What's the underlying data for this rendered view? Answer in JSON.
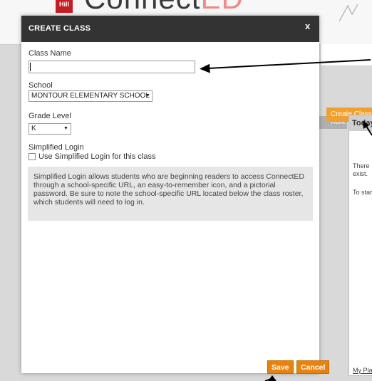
{
  "background": {
    "logo_small": "Hill",
    "logo_text": "Connect",
    "logo_text_accent": "ED",
    "create_class_button": "Create Class",
    "tab_partial": "nent",
    "panel": {
      "heading": "Today",
      "text_line1": "There",
      "text_line2": "exist.",
      "text_line3": "To star",
      "footer_link": "My Plan"
    }
  },
  "modal": {
    "title": "CREATE CLASS",
    "close_label": "x",
    "class_name": {
      "label": "Class Name",
      "value": ""
    },
    "school": {
      "label": "School",
      "selected": "MONTOUR ELEMENTARY SCHOOL"
    },
    "grade_level": {
      "label": "Grade Level",
      "selected": "K"
    },
    "simplified_login": {
      "label": "Simplified Login",
      "checkbox_label": "Use Simplified Login for this class",
      "checked": false,
      "info_text": "Simplified Login allows students who are beginning readers to access ConnectED through a school-specific URL, an easy-to-remember icon, and a pictorial password. Be sure to note the school-specific URL located below the class roster, which students will need to log in."
    },
    "save_label": "Save",
    "cancel_label": "Cancel"
  },
  "colors": {
    "header_bg": "#333333",
    "accent_orange": "#e8820e",
    "info_bg": "#e6e6e6",
    "brand_red": "#c41e24"
  },
  "icons": {
    "close": "close-icon",
    "dropdown": "chevron-down-icon",
    "arrow": "pointer-arrow-icon"
  }
}
